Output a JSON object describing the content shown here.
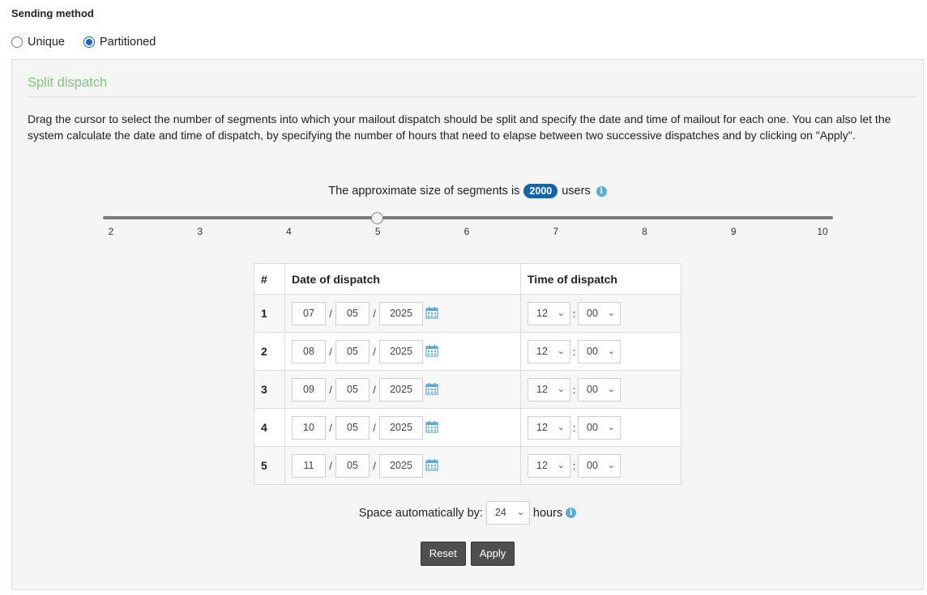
{
  "sending_method": {
    "title": "Sending method",
    "options": [
      {
        "label": "Unique",
        "checked": false
      },
      {
        "label": "Partitioned",
        "checked": true
      }
    ]
  },
  "split": {
    "title": "Split dispatch",
    "description": "Drag the cursor to select the number of segments into which your mailout dispatch should be split and specify the date and time of mailout for each one. You can also let the system calculate the date and time of dispatch, by specifying the number of hours that need to elapse between two successive dispatches and by clicking on \"Apply\".",
    "segment_text_before": "The approximate size of segments is",
    "segment_size": "2000",
    "segment_text_after": "users",
    "slider": {
      "ticks": [
        "2",
        "3",
        "4",
        "5",
        "6",
        "7",
        "8",
        "9",
        "10"
      ],
      "min": 2,
      "max": 10,
      "value": 5
    },
    "table": {
      "headers": {
        "num": "#",
        "date": "Date of dispatch",
        "time": "Time of dispatch"
      },
      "rows": [
        {
          "num": "1",
          "day": "07",
          "month": "05",
          "year": "2025",
          "hour": "12",
          "minute": "00"
        },
        {
          "num": "2",
          "day": "08",
          "month": "05",
          "year": "2025",
          "hour": "12",
          "minute": "00"
        },
        {
          "num": "3",
          "day": "09",
          "month": "05",
          "year": "2025",
          "hour": "12",
          "minute": "00"
        },
        {
          "num": "4",
          "day": "10",
          "month": "05",
          "year": "2025",
          "hour": "12",
          "minute": "00"
        },
        {
          "num": "5",
          "day": "11",
          "month": "05",
          "year": "2025",
          "hour": "12",
          "minute": "00"
        }
      ]
    },
    "space": {
      "label": "Space automatically by:",
      "value": "24",
      "unit": "hours"
    },
    "buttons": {
      "reset": "Reset",
      "apply": "Apply"
    },
    "date_separator": "/",
    "time_separator": ":"
  },
  "colors": {
    "accent": "#1a66c9",
    "badge": "#1563a8",
    "panel_title": "#86c47e",
    "info_icon": "#5aaad8",
    "calendar_icon": "#5aaad8",
    "button": "#4f4f4f"
  },
  "icons": {
    "info": "info-icon",
    "calendar": "calendar-icon",
    "dropdown": "chevron-down-icon"
  }
}
